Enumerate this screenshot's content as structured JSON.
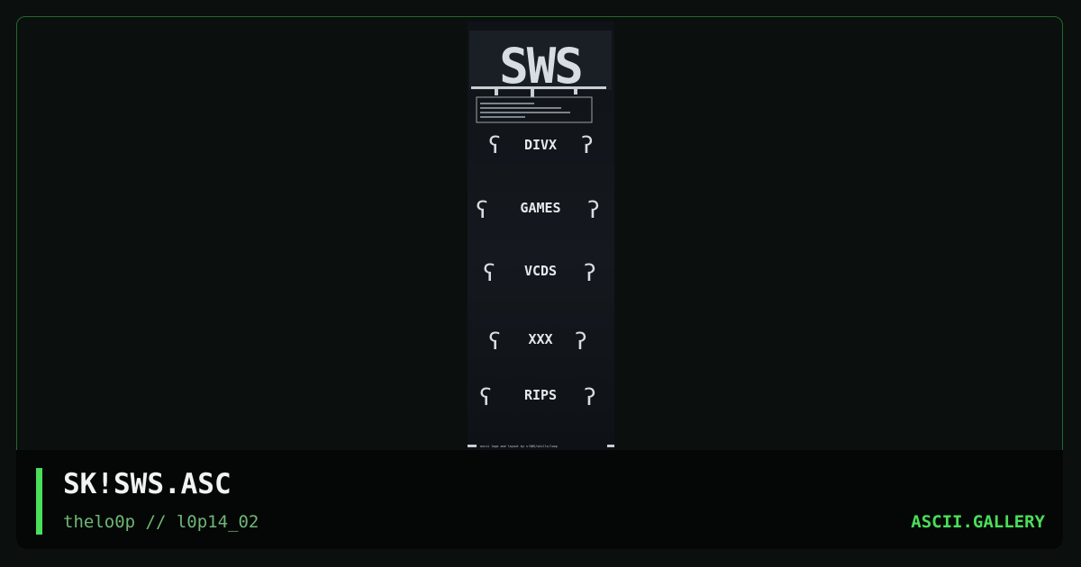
{
  "card": {
    "title": "SK!SWS.ASC",
    "subtitle": "thelo0p // l0p14_02",
    "brand": "ASCII.GALLERY"
  },
  "art": {
    "logo_text": "SWS",
    "sections": [
      "DIVX",
      "GAMES",
      "VCDS",
      "XXX",
      "RIPS"
    ],
    "footer_line": "ascii logo and layout by s!SWS/skillz/loop"
  },
  "colors": {
    "frame_border": "#1f6a2b",
    "accent": "#4ade5a",
    "subtitle": "#6fb677",
    "title": "#f2f2f2"
  }
}
